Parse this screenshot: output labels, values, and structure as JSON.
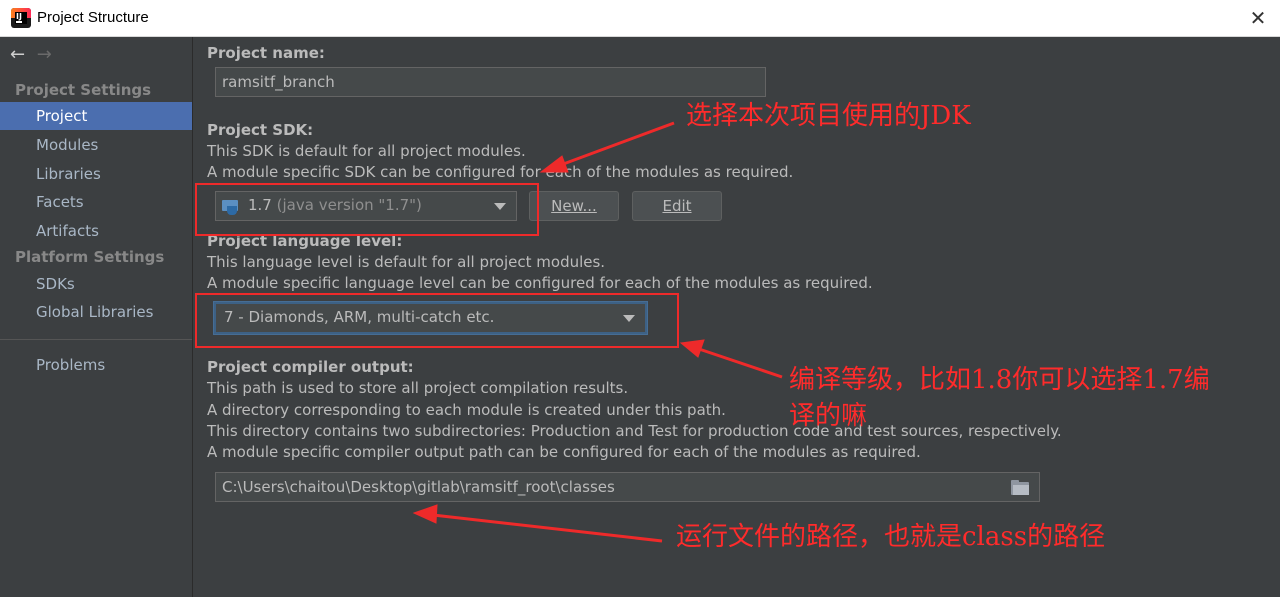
{
  "window": {
    "title": "Project Structure",
    "close_glyph": "✕"
  },
  "nav": {
    "back_glyph": "←",
    "forward_glyph": "→"
  },
  "sidebar": {
    "project_settings_header": "Project Settings",
    "project_settings_items": [
      {
        "label": "Project",
        "selected": true
      },
      {
        "label": "Modules"
      },
      {
        "label": "Libraries"
      },
      {
        "label": "Facets"
      },
      {
        "label": "Artifacts"
      }
    ],
    "platform_settings_header": "Platform Settings",
    "platform_settings_items": [
      {
        "label": "SDKs"
      },
      {
        "label": "Global Libraries"
      }
    ],
    "problems_label": "Problems"
  },
  "project_name": {
    "label": "Project name:",
    "value": "ramsitf_branch"
  },
  "project_sdk": {
    "label": "Project SDK:",
    "desc1": "This SDK is default for all project modules.",
    "desc2": "A module specific SDK can be configured for each of the modules as required.",
    "selected_version": "1.7",
    "selected_detail": "(java version \"1.7\")",
    "new_button": "New...",
    "edit_button": "Edit"
  },
  "language_level": {
    "label": "Project language level:",
    "desc1": "This language level is default for all project modules.",
    "desc2": "A module specific language level can be configured for each of the modules as required.",
    "selected": "7 - Diamonds, ARM, multi-catch etc."
  },
  "compiler_output": {
    "label": "Project compiler output:",
    "desc1": "This path is used to store all project compilation results.",
    "desc2": "A directory corresponding to each module is created under this path.",
    "desc3": "This directory contains two subdirectories: Production and Test for production code and test sources, respectively.",
    "desc4": "A module specific compiler output path can be configured for each of the modules as required.",
    "path": "C:\\Users\\chaitou\\Desktop\\gitlab\\ramsitf_root\\classes"
  },
  "annotations": {
    "sdk_note": "选择本次项目使用的JDK",
    "level_note_line1": "编译等级，比如1.8你可以选择1.7编",
    "level_note_line2": "译的嘛",
    "output_note": "运行文件的路径，也就是class的路径",
    "color": "#ff2b2b"
  },
  "colors": {
    "background": "#3c3f41",
    "selection": "#4b6eaf",
    "text": "#bbbbbb"
  }
}
